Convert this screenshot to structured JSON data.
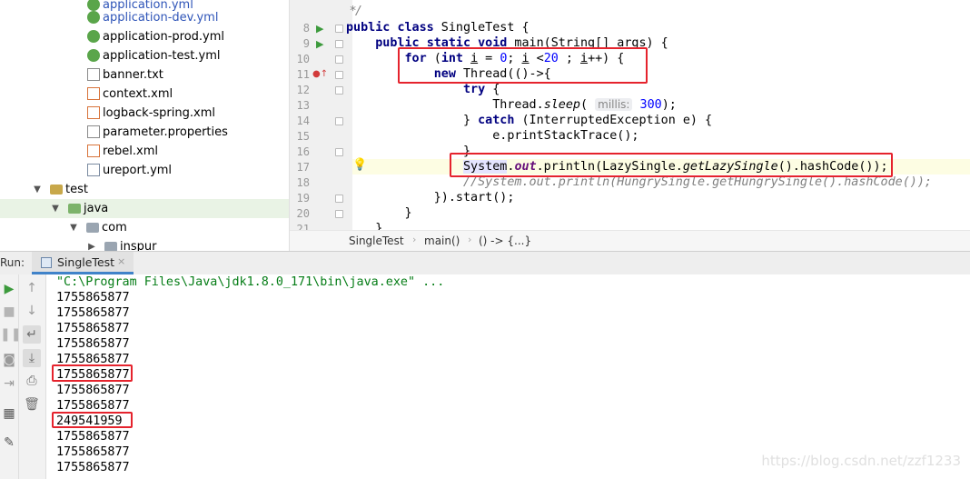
{
  "project_tree": {
    "items": [
      {
        "label": "application.yml",
        "type": "yml",
        "vcs": true
      },
      {
        "label": "application-dev.yml",
        "type": "yml",
        "vcs": true
      },
      {
        "label": "application-prod.yml",
        "type": "yml",
        "vcs": false
      },
      {
        "label": "application-test.yml",
        "type": "yml",
        "vcs": false
      },
      {
        "label": "banner.txt",
        "type": "txt",
        "vcs": false
      },
      {
        "label": "context.xml",
        "type": "xml",
        "vcs": false
      },
      {
        "label": "logback-spring.xml",
        "type": "xml",
        "vcs": false
      },
      {
        "label": "parameter.properties",
        "type": "properties",
        "vcs": false
      },
      {
        "label": "rebel.xml",
        "type": "xml",
        "vcs": false
      },
      {
        "label": "ureport.yml",
        "type": "grid",
        "vcs": false
      },
      {
        "label": "test",
        "type": "folder",
        "vcs": false
      },
      {
        "label": "java",
        "type": "source-folder",
        "vcs": false
      },
      {
        "label": "com",
        "type": "package",
        "vcs": false
      },
      {
        "label": "inspur",
        "type": "package",
        "vcs": false
      }
    ]
  },
  "editor": {
    "lines": [
      {
        "num": "8"
      },
      {
        "num": "9"
      },
      {
        "num": "10"
      },
      {
        "num": "11"
      },
      {
        "num": "12"
      },
      {
        "num": "13"
      },
      {
        "num": "14"
      },
      {
        "num": "15"
      },
      {
        "num": "16"
      },
      {
        "num": "17"
      },
      {
        "num": "18"
      },
      {
        "num": "19"
      },
      {
        "num": "20"
      },
      {
        "num": "21"
      }
    ],
    "code": {
      "l7_comment": " */",
      "l8_kw1": "public",
      "l8_kw2": "class",
      "l8_rest": " SingleTest {",
      "l9_kw1": "public",
      "l9_kw2": "static",
      "l9_kw3": "void",
      "l9_rest": " main(String[] args) {",
      "l10_kw1": "for",
      "l10_kw2": "int",
      "l10_i": "i",
      "l10_eq": " = ",
      "l10_zero": "0",
      "l10_semi": "; ",
      "l10_lt": " <",
      "l10_twenty": "20",
      "l10_semi2": " ; ",
      "l10_inc": "++) {",
      "l11_kw": "new",
      "l11_rest": " Thread(()->{",
      "l12_kw": "try",
      "l12_rest": " {",
      "l13_cls": "Thread.",
      "l13_method": "sleep",
      "l13_open": "(",
      "l13_hint": "millis:",
      "l13_val": "300",
      "l13_close": ");",
      "l14_open": "} ",
      "l14_kw": "catch",
      "l14_rest": " (InterruptedException e) {",
      "l15": "e.printStackTrace();",
      "l16": "}",
      "l17_system": "System",
      "l17_dot": ".",
      "l17_out": "out",
      "l17_println": ".println(LazySingle.",
      "l17_static": "getLazySingle",
      "l17_rest": "().hashCode());",
      "l18": "//System.out.println(HungrySingle.getHungrySingle().hashCode());",
      "l19_open": "}).start();",
      "l20": "}",
      "l21": "}"
    }
  },
  "breadcrumb": {
    "items": [
      "SingleTest",
      "main()",
      "() -> {...}"
    ]
  },
  "run_panel": {
    "run_label": "Run:",
    "tab_label": "SingleTest",
    "tab_close": "×",
    "command": "\"C:\\Program Files\\Java\\jdk1.8.0_171\\bin\\java.exe\" ...",
    "output": [
      "1755865877",
      "1755865877",
      "1755865877",
      "1755865877",
      "1755865877",
      "1755865877",
      "1755865877",
      "1755865877",
      "249541959",
      "1755865877",
      "1755865877",
      "1755865877"
    ]
  },
  "watermark": "https://blog.csdn.net/zzf1233",
  "colors": {
    "annotation_red": "#e5232d",
    "keyword": "#000080",
    "number": "#0000ff",
    "console_cmd": "#067d17"
  }
}
